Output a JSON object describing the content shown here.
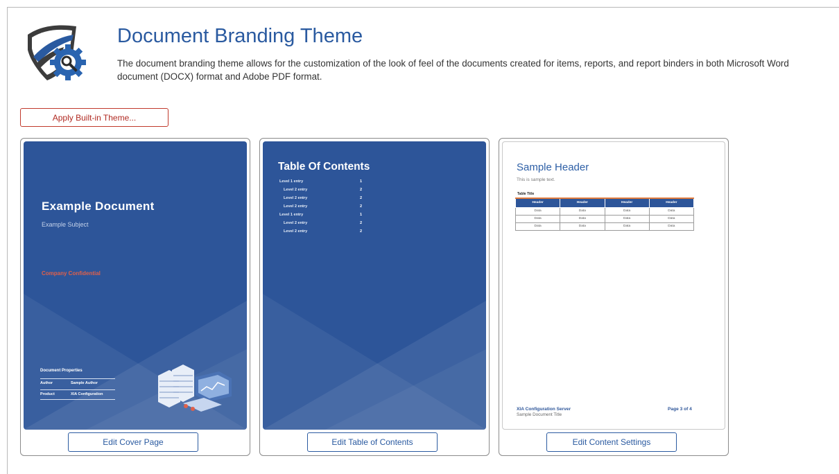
{
  "header": {
    "title": "Document Branding Theme",
    "description": "The document branding theme allows for the customization of the look of feel of the documents created for items, reports, and report binders in both Microsoft Word document (DOCX) format and Adobe PDF format."
  },
  "apply_button": "Apply Built-in Theme...",
  "cover": {
    "title": "Example Document",
    "subject": "Example Subject",
    "confidential": "Company Confidential",
    "props_title": "Document Properties",
    "props": [
      {
        "key": "Author",
        "value": "Sample Author"
      },
      {
        "key": "Product",
        "value": "XIA Configuration"
      }
    ],
    "button": "Edit Cover Page"
  },
  "toc": {
    "title": "Table Of Contents",
    "entries": [
      {
        "label": "Level 1 entry",
        "page": "1"
      },
      {
        "label": "Level 2 entry",
        "page": "2"
      },
      {
        "label": "Level 2 entry",
        "page": "2"
      },
      {
        "label": "Level 2 entry",
        "page": "2"
      },
      {
        "label": "Level 1 entry",
        "page": "1"
      },
      {
        "label": "Level 2 entry",
        "page": "2"
      },
      {
        "label": "Level 2 entry",
        "page": "2"
      }
    ],
    "button": "Edit Table of Contents"
  },
  "content": {
    "header": "Sample Header",
    "text": "This is sample text.",
    "table_title": "Table Title",
    "columns": [
      "Header",
      "Header",
      "Header",
      "Header"
    ],
    "rows": [
      [
        "Data",
        "Data",
        "Data",
        "Data"
      ],
      [
        "Data",
        "Data",
        "Data",
        "Data"
      ],
      [
        "Data",
        "Data",
        "Data",
        "Data"
      ]
    ],
    "footer_company": "XIA Configuration Server",
    "footer_doc": "Sample Document Title",
    "footer_page": "Page 3 of 4",
    "button": "Edit Content Settings"
  },
  "colors": {
    "brand_blue": "#2d5599",
    "title_blue": "#2a5aa0",
    "apply_red": "#c0392b",
    "confidential": "#e0604a",
    "table_accent": "#e07a3c"
  }
}
